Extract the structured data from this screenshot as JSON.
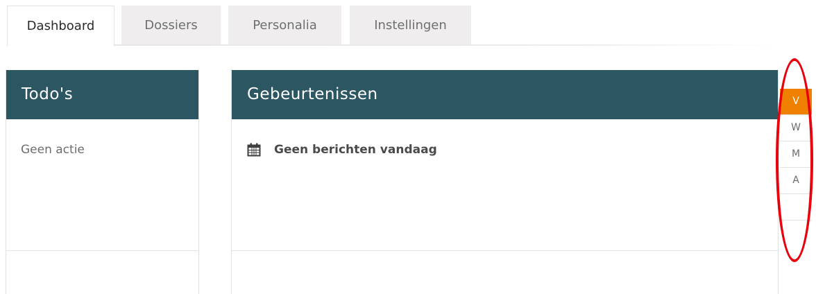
{
  "tabs": [
    {
      "label": "Dashboard",
      "active": true
    },
    {
      "label": "Dossiers",
      "active": false
    },
    {
      "label": "Personalia",
      "active": false
    },
    {
      "label": "Instellingen",
      "active": false
    }
  ],
  "todos": {
    "title": "Todo's",
    "empty_text": "Geen actie"
  },
  "events": {
    "title": "Gebeurtenissen",
    "empty_text": "Geen berichten vandaag",
    "icon": "calendar-icon"
  },
  "period_selector": {
    "options": [
      "V",
      "W",
      "M",
      "A"
    ],
    "selected": "V",
    "highlight_color": "#e8000b",
    "active_color": "#f08000"
  },
  "colors": {
    "header_bg": "#2c5662",
    "tab_inactive_bg": "#efeded"
  }
}
